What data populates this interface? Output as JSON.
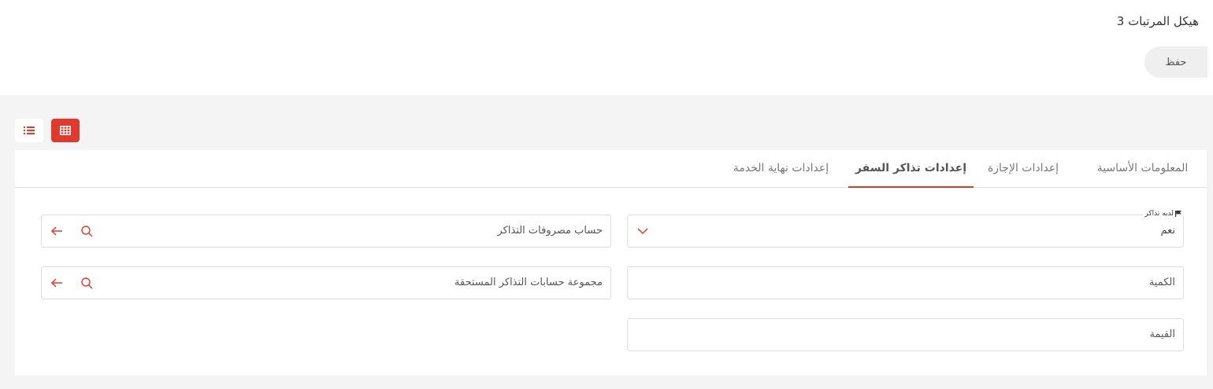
{
  "header": {
    "title": "هيكل المرتبات 3",
    "save_label": "حفظ"
  },
  "toolbar": {
    "list_view_icon": "list-icon",
    "grid_view_icon": "grid-icon",
    "accent_color": "#e03a2f"
  },
  "tabs": [
    {
      "label": "المعلومات الأساسية",
      "active": false
    },
    {
      "label": "إعدادات الإجازة",
      "active": false
    },
    {
      "label": "إعدادات تذاكر السفر",
      "active": true
    },
    {
      "label": "إعدادات نهاية الخدمة",
      "active": false
    }
  ],
  "form": {
    "has_tickets": {
      "label": "لديه تذاكر",
      "value": "نعم"
    },
    "quantity": {
      "placeholder": "الكمية"
    },
    "value": {
      "placeholder": "القيمة"
    },
    "ticket_expense_account": {
      "placeholder": "حساب مصروفات التذاكر"
    },
    "payable_accounts_group": {
      "placeholder": "مجموعة حسابات التذاكر المستحقة"
    }
  }
}
